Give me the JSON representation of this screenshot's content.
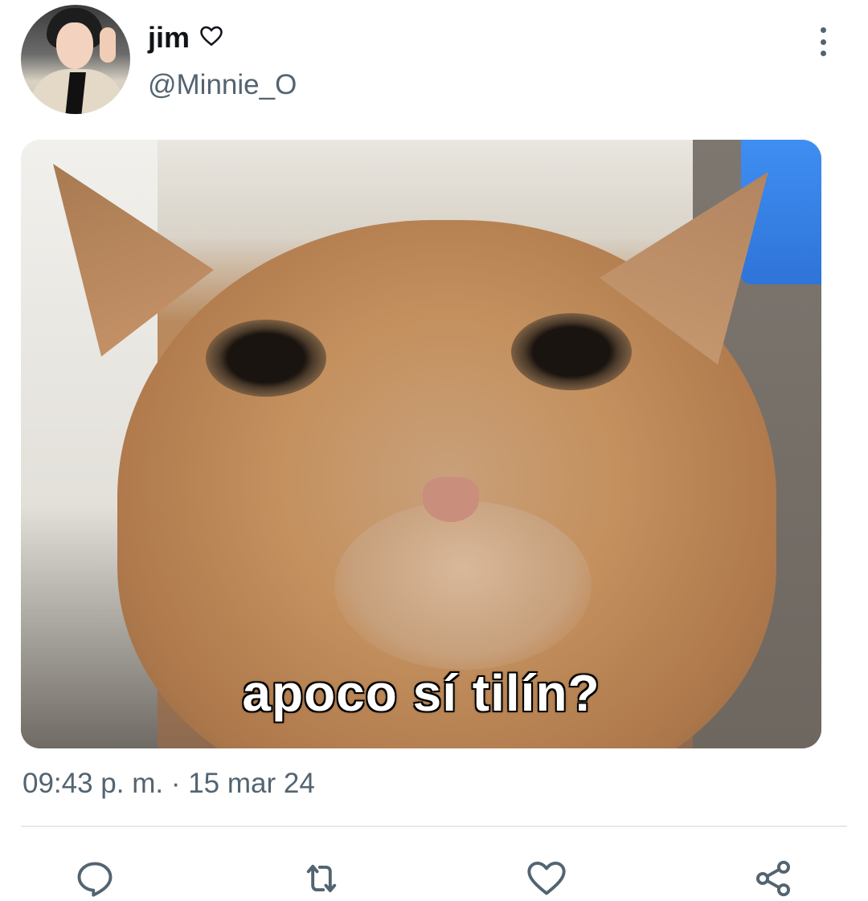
{
  "author": {
    "display_name": "jim",
    "handle": "@Minnie_O",
    "name_badge_icon": "heart-outline-icon"
  },
  "media": {
    "caption": "apoco sí tilín?"
  },
  "tweet": {
    "timestamp": "09:43 p. m. · 15 mar 24"
  },
  "actions": [
    {
      "icon": "reply-icon"
    },
    {
      "icon": "retweet-icon"
    },
    {
      "icon": "like-icon"
    },
    {
      "icon": "share-icon"
    }
  ],
  "colors": {
    "text_primary": "#0f1419",
    "text_secondary": "#536471",
    "divider": "#e6e9ec"
  }
}
